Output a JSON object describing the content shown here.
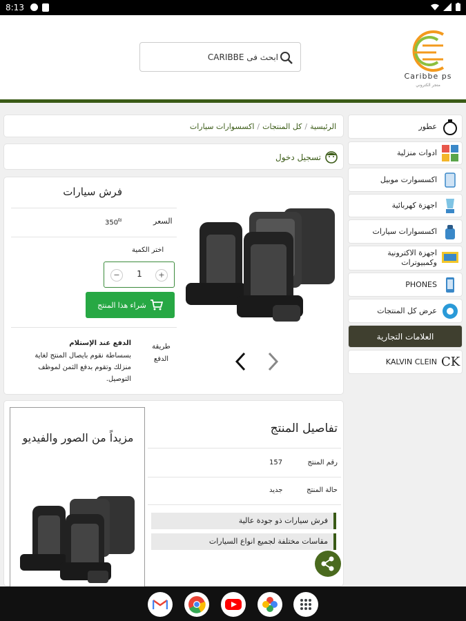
{
  "status": {
    "time": "8:13"
  },
  "header": {
    "logo_text": "Caribbe ps",
    "logo_sub": "متجر الكتروني",
    "search_placeholder": "ابحث فى CARIBBE"
  },
  "sidebar": {
    "items": [
      {
        "label": "عطور",
        "icon": "perfume-icon"
      },
      {
        "label": "ادوات منزلية",
        "icon": "household-icon"
      },
      {
        "label": "اكسسوارت موبيل",
        "icon": "mobile-accessory-icon"
      },
      {
        "label": "اجهزة كهربائية",
        "icon": "blender-icon"
      },
      {
        "label": "اكسسوارات سيارات",
        "icon": "car-accessory-icon"
      },
      {
        "label": "اجهزة الاكترونية وكمبيوترات",
        "icon": "computer-icon"
      },
      {
        "label": "PHONES",
        "icon": "phone-icon"
      },
      {
        "label": "عرض كل المنتجات",
        "icon": "all-products-icon"
      }
    ],
    "brands_title": "العلامات التجارية",
    "brands": [
      {
        "label": "KALVIN CLEIN",
        "logo": "CK"
      }
    ]
  },
  "breadcrumb": {
    "items": [
      "الرئيسية",
      "كل المنتجات",
      "اكسسوارات سيارات"
    ],
    "separator": "/"
  },
  "login": {
    "label": "تسجيل دخول"
  },
  "product": {
    "title": "فرش سيارات",
    "price_label": "السعر",
    "price_value": "350",
    "currency": "₪",
    "qty_label": "اختر الكمية",
    "quantity": "1",
    "plus": "+",
    "minus": "−",
    "buy_label": "شراء هذا المنتج",
    "payment_label": "طريقة الدفع",
    "payment_title": "الدفع عند الإستلام",
    "payment_desc": "بسساطة نقوم بايصال المنتج لغاية منزلك وتقوم بدفع الثمن لموظف التوصيل."
  },
  "details": {
    "title": "تفاصيل المنتج",
    "rows": [
      {
        "label": "رقم المنتج",
        "value": "157"
      },
      {
        "label": "حالة المنتج",
        "value": "جديد"
      }
    ],
    "features": [
      "فرش سيارات ذو جودة عالية",
      "مقاسات مختلفة لجميع انواع السيارات"
    ],
    "media_title": "مزيداً من الصور والفيديو"
  },
  "colors": {
    "accent": "#3a5a16",
    "buy": "#27a844",
    "brands_bg": "#3f3f2f"
  }
}
